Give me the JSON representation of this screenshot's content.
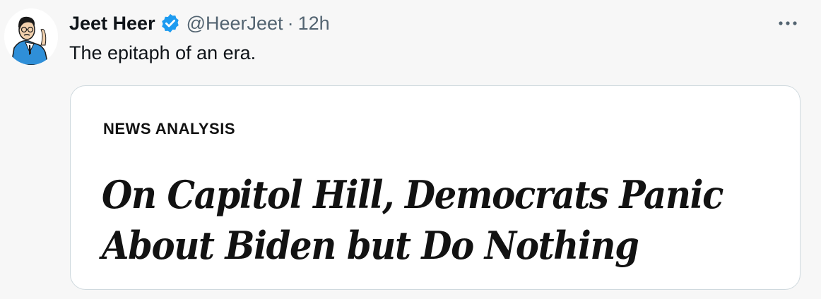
{
  "tweet": {
    "author": {
      "display_name": "Jeet Heer",
      "handle": "@HeerJeet",
      "verified": true,
      "avatar_icon": "cartoon-portrait-avatar"
    },
    "separator": "·",
    "time": "12h",
    "more_icon": "more-dots-icon",
    "more_label": "···",
    "text": "The epitaph of an era."
  },
  "media": {
    "kicker": "NEWS ANALYSIS",
    "headline_line1": "On Capitol Hill, Democrats Panic",
    "headline_line2": "About Biden but Do Nothing"
  },
  "colors": {
    "verified_blue": "#1d9bf0",
    "secondary_text": "#536471",
    "background": "#f7f7f7"
  }
}
